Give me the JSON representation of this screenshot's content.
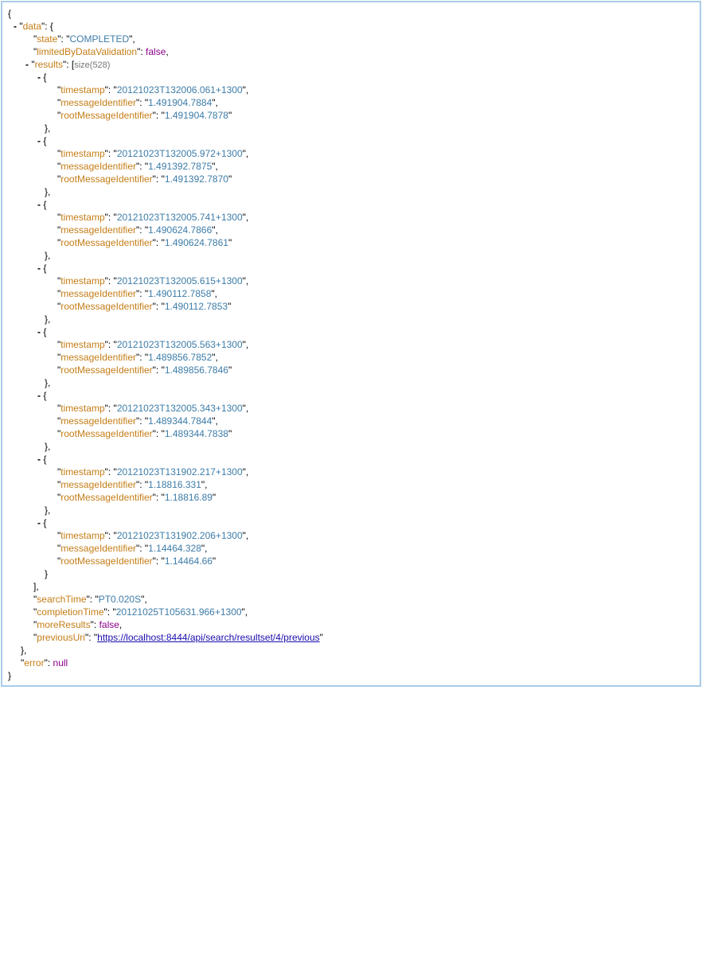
{
  "json": {
    "open_brace": "{",
    "close_brace": "}",
    "data_key": "data",
    "data": {
      "state_key": "state",
      "state": "COMPLETED",
      "limited_key": "limitedByDataValidation",
      "limited": "false",
      "results_key": "results",
      "results_size": "size(528)",
      "entry_keys": {
        "timestamp": "timestamp",
        "messageIdentifier": "messageIdentifier",
        "rootMessageIdentifier": "rootMessageIdentifier"
      },
      "results": [
        {
          "timestamp": "20121023T132006.061+1300",
          "messageIdentifier": "1.491904.7884",
          "rootMessageIdentifier": "1.491904.7878"
        },
        {
          "timestamp": "20121023T132005.972+1300",
          "messageIdentifier": "1.491392.7875",
          "rootMessageIdentifier": "1.491392.7870"
        },
        {
          "timestamp": "20121023T132005.741+1300",
          "messageIdentifier": "1.490624.7866",
          "rootMessageIdentifier": "1.490624.7861"
        },
        {
          "timestamp": "20121023T132005.615+1300",
          "messageIdentifier": "1.490112.7858",
          "rootMessageIdentifier": "1.490112.7853"
        },
        {
          "timestamp": "20121023T132005.563+1300",
          "messageIdentifier": "1.489856.7852",
          "rootMessageIdentifier": "1.489856.7846"
        },
        {
          "timestamp": "20121023T132005.343+1300",
          "messageIdentifier": "1.489344.7844",
          "rootMessageIdentifier": "1.489344.7838"
        },
        {
          "timestamp": "20121023T131902.217+1300",
          "messageIdentifier": "1.18816.331",
          "rootMessageIdentifier": "1.18816.89"
        },
        {
          "timestamp": "20121023T131902.206+1300",
          "messageIdentifier": "1.14464.328",
          "rootMessageIdentifier": "1.14464.66"
        }
      ],
      "searchTime_key": "searchTime",
      "searchTime": "PT0.020S",
      "completionTime_key": "completionTime",
      "completionTime": "20121025T105631.966+1300",
      "moreResults_key": "moreResults",
      "moreResults": "false",
      "previousUri_key": "previousUri",
      "previousUri": "https://localhost:8444/api/search/resultset/4/previous"
    },
    "error_key": "error",
    "error": "null"
  },
  "colors": {
    "key": "#c47d16",
    "string": "#3d7ca8",
    "literal": "#8b008b",
    "border": "#a9cbe8",
    "link": "#1a0dab"
  },
  "icons": {
    "collapse_toggle": "minus-toggle-icon"
  }
}
